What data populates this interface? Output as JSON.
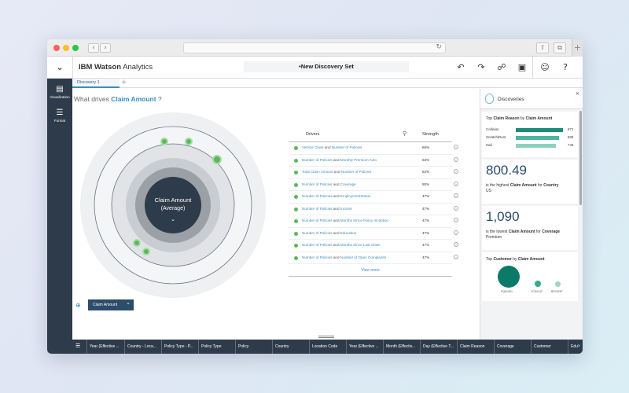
{
  "header": {
    "brand_bold": "IBM Watson",
    "brand_light": " Analytics",
    "set_title": "•New Discovery Set"
  },
  "rail": [
    {
      "label": "Visualization",
      "icon": "bar-chart-icon"
    },
    {
      "label": "Format",
      "icon": "sliders-icon"
    }
  ],
  "tabs": [
    {
      "label": "Discovery 1"
    }
  ],
  "question": {
    "prefix": "What drives ",
    "target": "Claim Amount",
    "suffix": " ?"
  },
  "viz": {
    "center_line1": "Claim Amount",
    "center_line2": "(Average)"
  },
  "drivers": {
    "header_label": "Drivers",
    "strength_label": "Strength",
    "rows": [
      {
        "a": "Vehicle Class",
        "b": "Number of Policies",
        "strength": "65%"
      },
      {
        "a": "Number of Policies",
        "b": "Monthly Premium Auto",
        "strength": "63%"
      },
      {
        "a": "Total Claim Amount",
        "b": "Number of Policies",
        "strength": "53%"
      },
      {
        "a": "Number of Policies",
        "b": "Coverage",
        "strength": "50%"
      },
      {
        "a": "Number of Policies",
        "b": "EmploymentStatus",
        "strength": "47%"
      },
      {
        "a": "Number of Policies",
        "b": "Income",
        "strength": "47%"
      },
      {
        "a": "Number of Policies",
        "b": "Months Since Policy Inception",
        "strength": "47%"
      },
      {
        "a": "Number of Policies",
        "b": "Education",
        "strength": "47%"
      },
      {
        "a": "Number of Policies",
        "b": "Months Since Last Claim",
        "strength": "47%"
      },
      {
        "a": "Number of Policies",
        "b": "Number of Open Complaints",
        "strength": "47%"
      }
    ],
    "and_word": "and",
    "view_more": "View more"
  },
  "target_button": {
    "label": "Claim Amount"
  },
  "discoveries": {
    "title": "Discoveries",
    "card1": {
      "title_pre": "Top ",
      "title_bold1": "Claim Reason",
      "title_mid": " by ",
      "title_bold2": "Claim Amount",
      "bars": [
        {
          "label": "Collision",
          "value": "871",
          "num": 871,
          "color": "#1a8c7c"
        },
        {
          "label": "Scratch/Dent",
          "value": "800",
          "num": 800,
          "color": "#4ab5a3"
        },
        {
          "label": "Hail",
          "value": "740",
          "num": 740,
          "color": "#8ad1c2"
        }
      ]
    },
    "card2": {
      "value": "800.49",
      "t1": "is the highest ",
      "b1": "Claim Amount",
      "t2": " for ",
      "b2": "Country",
      "t3": "US"
    },
    "card3": {
      "value": "1,090",
      "t1": "is the lowest ",
      "b1": "Claim Amount",
      "t2": " for ",
      "b2": "Coverage",
      "t3": "Premium"
    },
    "card4": {
      "title_pre": "Top ",
      "title_bold1": "Customer",
      "title_mid": " by ",
      "title_bold2": "Claim Amount",
      "bubbles": [
        {
          "label": "FQ61281",
          "color": "#0b7a68"
        },
        {
          "label": "YC54142",
          "color": "#3aa88f"
        },
        {
          "label": "BP23267",
          "color": "#9ed3c8"
        }
      ]
    }
  },
  "columns": [
    "Year (Effective ...",
    "Country - Loca...",
    "Policy Type - P...",
    "Policy Type",
    "Policy",
    "Country",
    "Location Code",
    "Year (Effective ...",
    "Month (Effectiv...",
    "Day (Effective T...",
    "Claim Reason",
    "Coverage",
    "Customer",
    "Edu"
  ],
  "colors": {
    "accent": "#3c8dbc",
    "rail": "#2e3b4a",
    "node": "#5cb85c"
  }
}
